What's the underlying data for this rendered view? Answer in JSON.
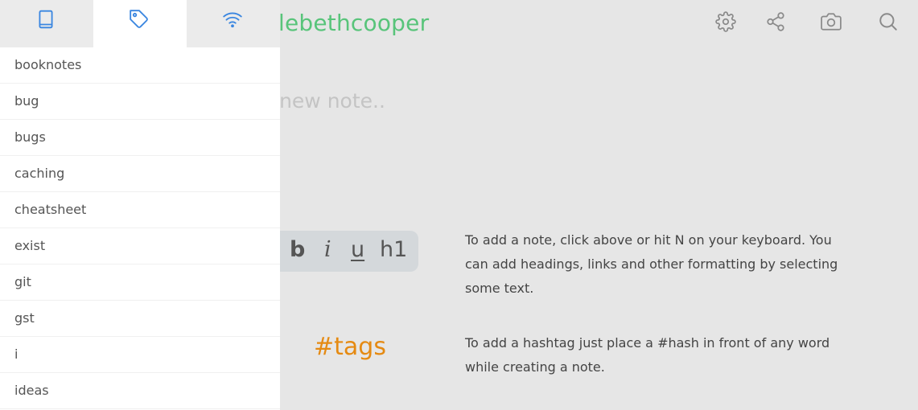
{
  "header": {
    "username": "llebethcooper",
    "icons": [
      "gear-icon",
      "share-icon",
      "camera-icon",
      "search-icon"
    ]
  },
  "editor": {
    "placeholder": "d a new note.."
  },
  "help": {
    "format_buttons": {
      "bold": "b",
      "italic": "i",
      "underline": "u",
      "heading": "h1"
    },
    "format_text": "To add a note, click above or hit N on your keyboard. You can add headings, links and other formatting by selecting some text.",
    "tags_sample": "#tags",
    "tags_text": "To add a hashtag just place a #hash in front of any word while creating a note."
  },
  "sidebar": {
    "tabs": [
      {
        "icon": "book-icon",
        "active": false
      },
      {
        "icon": "tag-icon",
        "active": true
      },
      {
        "icon": "wifi-icon",
        "active": false
      }
    ],
    "tags": [
      {
        "label": "booknotes"
      },
      {
        "label": "bug"
      },
      {
        "label": "bugs"
      },
      {
        "label": "caching"
      },
      {
        "label": "cheatsheet"
      },
      {
        "label": "exist"
      },
      {
        "label": "git"
      },
      {
        "label": "gst"
      },
      {
        "label": "i"
      },
      {
        "label": "ideas"
      }
    ]
  },
  "colors": {
    "accent": "#3a86e0",
    "username": "#58c47a",
    "hashtag": "#e58a12",
    "icon_gray": "#8a8a8a"
  }
}
